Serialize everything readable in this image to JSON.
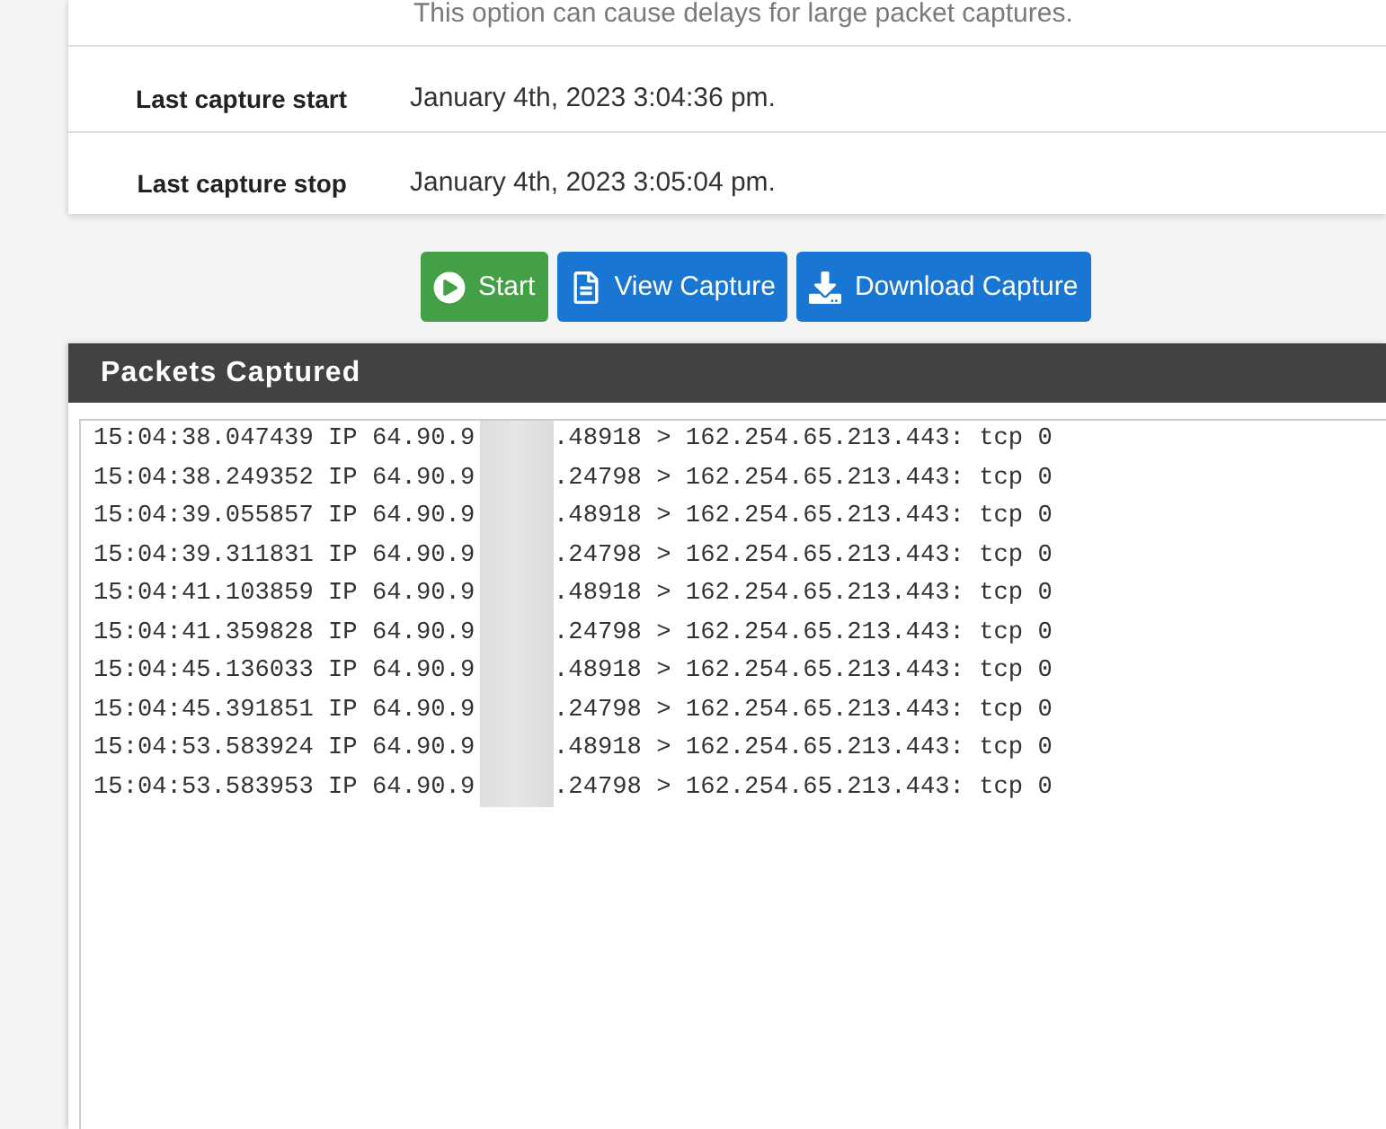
{
  "help_text": "This option can cause delays for large packet captures.",
  "fields": [
    {
      "label": "Last capture start",
      "value": "January 4th, 2023 3:04:36 pm."
    },
    {
      "label": "Last capture stop",
      "value": "January 4th, 2023 3:05:04 pm."
    }
  ],
  "buttons": [
    {
      "kind": "start",
      "label": "Start"
    },
    {
      "kind": "view",
      "label": "View Capture"
    },
    {
      "kind": "download",
      "label": "Download Capture"
    }
  ],
  "packets_panel": {
    "title": "Packets Captured",
    "lines": [
      {
        "before": "15:04:38.047439 IP 64.90.9",
        "after": ".48918 > 162.254.65.213.443: tcp 0"
      },
      {
        "before": "15:04:38.249352 IP 64.90.9",
        "after": ".24798 > 162.254.65.213.443: tcp 0"
      },
      {
        "before": "15:04:39.055857 IP 64.90.9",
        "after": ".48918 > 162.254.65.213.443: tcp 0"
      },
      {
        "before": "15:04:39.311831 IP 64.90.9",
        "after": ".24798 > 162.254.65.213.443: tcp 0"
      },
      {
        "before": "15:04:41.103859 IP 64.90.9",
        "after": ".48918 > 162.254.65.213.443: tcp 0"
      },
      {
        "before": "15:04:41.359828 IP 64.90.9",
        "after": ".24798 > 162.254.65.213.443: tcp 0"
      },
      {
        "before": "15:04:45.136033 IP 64.90.9",
        "after": ".48918 > 162.254.65.213.443: tcp 0"
      },
      {
        "before": "15:04:45.391851 IP 64.90.9",
        "after": ".24798 > 162.254.65.213.443: tcp 0"
      },
      {
        "before": "15:04:53.583924 IP 64.90.9",
        "after": ".48918 > 162.254.65.213.443: tcp 0"
      },
      {
        "before": "15:04:53.583953 IP 64.90.9",
        "after": ".24798 > 162.254.65.213.443: tcp 0"
      }
    ]
  }
}
